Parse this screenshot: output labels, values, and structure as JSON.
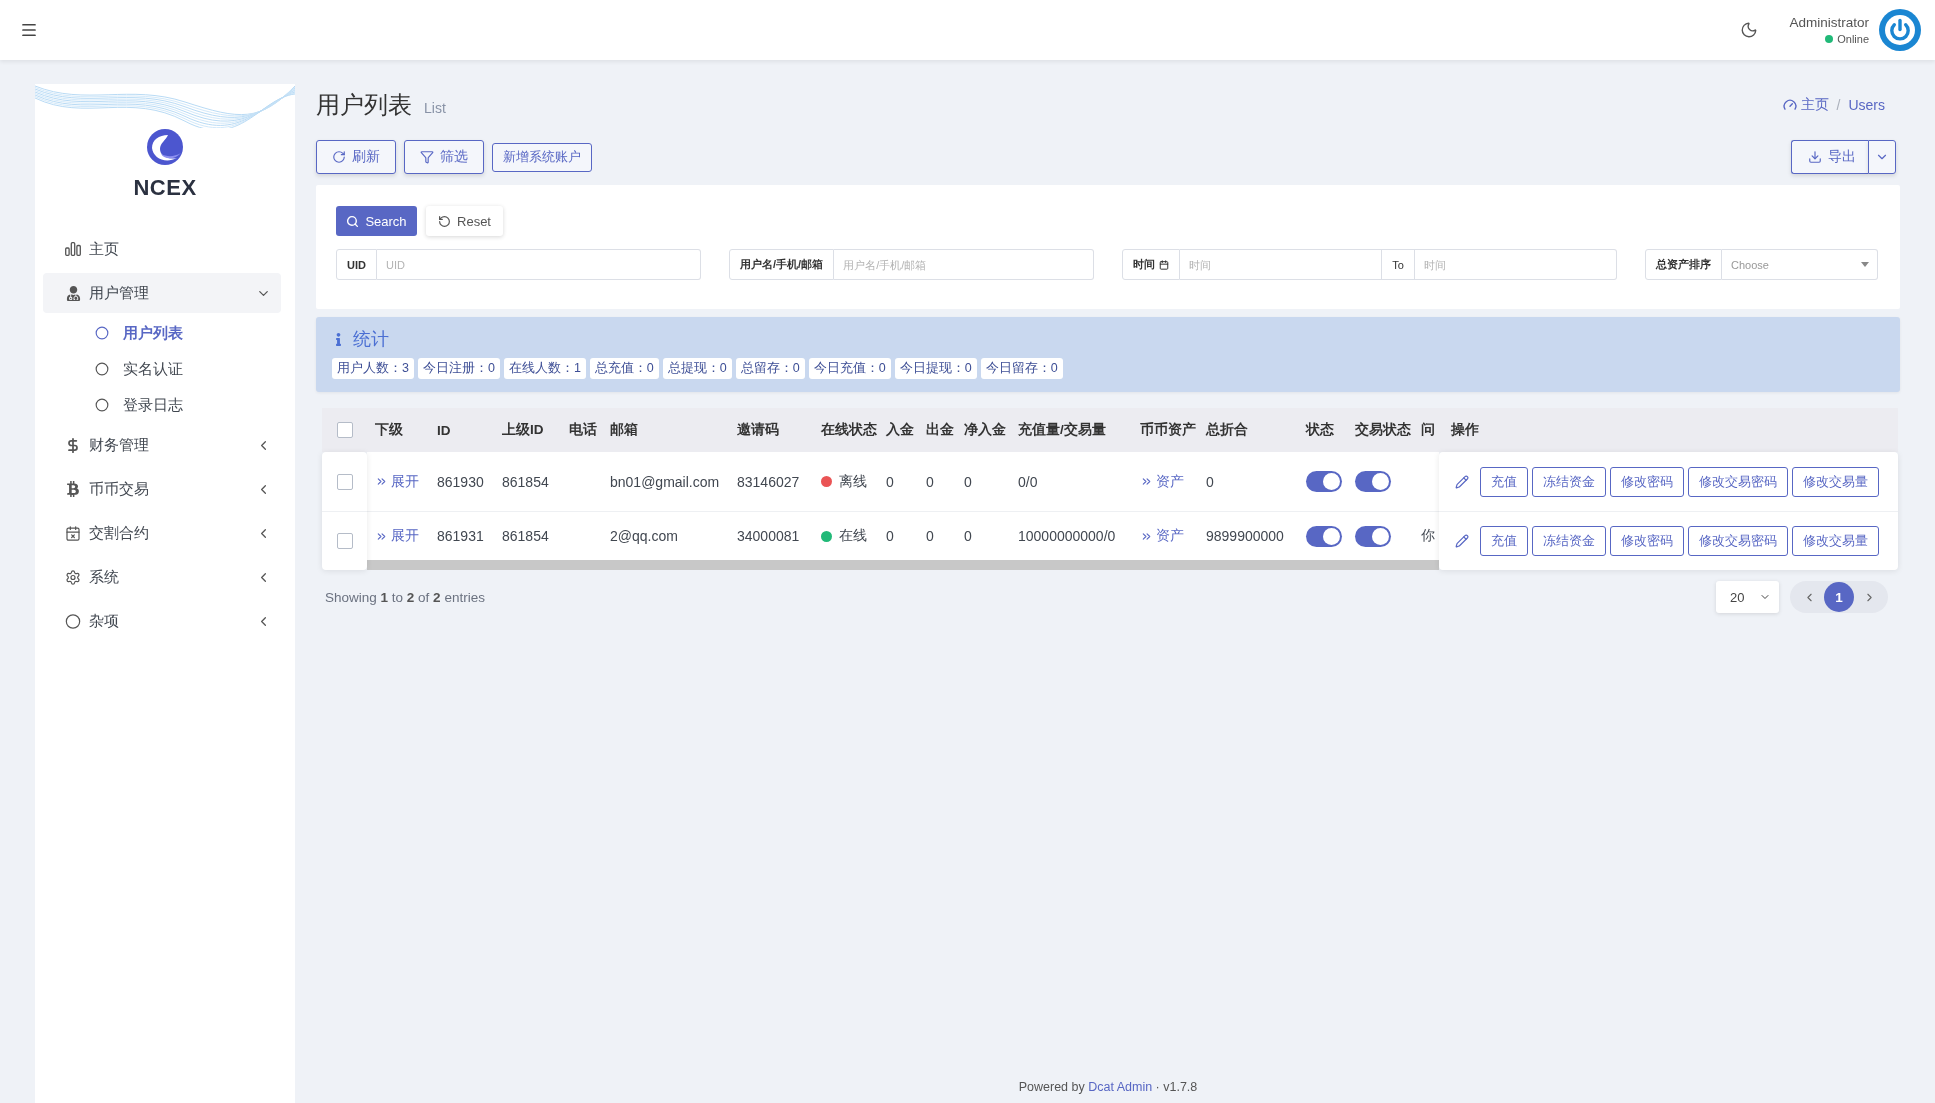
{
  "header": {
    "user_name": "Administrator",
    "user_status": "Online"
  },
  "sidebar": {
    "brand": "NCEX",
    "items": [
      {
        "label": "主页",
        "selected": false
      },
      {
        "label": "用户管理",
        "selected": false,
        "expanded": true,
        "children": [
          {
            "label": "用户列表",
            "selected": true
          },
          {
            "label": "实名认证",
            "selected": false
          },
          {
            "label": "登录日志",
            "selected": false
          }
        ]
      },
      {
        "label": "财务管理",
        "selected": false,
        "expanded": false
      },
      {
        "label": "币币交易",
        "selected": false,
        "expanded": false
      },
      {
        "label": "交割合约",
        "selected": false,
        "expanded": false
      },
      {
        "label": "系统",
        "selected": false,
        "expanded": false
      },
      {
        "label": "杂项",
        "selected": false,
        "expanded": false
      }
    ]
  },
  "page": {
    "title": "用户列表",
    "subtitle": "List",
    "breadcrumb": {
      "items": [
        "主页",
        "Users"
      ],
      "separator": "/"
    }
  },
  "toolbar": {
    "buttons": [
      {
        "kind": "refresh",
        "label": "刷新"
      },
      {
        "kind": "filter",
        "label": "筛选"
      },
      {
        "kind": "create",
        "label": "新增系统账户"
      }
    ],
    "export": {
      "label": "导出"
    }
  },
  "filter": {
    "search": "Search",
    "reset": "Reset",
    "fields": [
      {
        "kind": "text",
        "label": "UID",
        "placeholder": "UID"
      },
      {
        "kind": "text",
        "label": "用户名/手机/邮箱",
        "placeholder": "用户名/手机/邮箱"
      },
      {
        "kind": "range",
        "label": "时间",
        "placeholder": "时间",
        "separator": "To",
        "end_placeholder": "时间"
      },
      {
        "kind": "select",
        "label": "总资产排序",
        "placeholder": "Choose"
      }
    ]
  },
  "stats": {
    "title": "统计",
    "items": [
      "用户人数：3",
      "今日注册：0",
      "在线人数：1",
      "总充值：0",
      "总提现：0",
      "总留存：0",
      "今日充值：0",
      "今日提现：0",
      "今日留存：0"
    ]
  },
  "table": {
    "select_all": {
      "checked": false
    },
    "columns": [
      "下级",
      "ID",
      "上级ID",
      "电话",
      "邮箱",
      "邀请码",
      "在线状态",
      "入金",
      "出金",
      "净入金",
      "充值量/交易量",
      "币币资产",
      "总折合",
      "状态",
      "交易状态",
      "问",
      "操作"
    ],
    "rows": [
      {
        "selected": false,
        "subordinates": "展开",
        "id": "861930",
        "parent_id": "861854",
        "email": "bn01@gmail.com",
        "invite_code": "83146027",
        "online": {
          "label": "离线",
          "color": "#ea5455"
        },
        "deposit": "0",
        "withdrawal": "0",
        "net_deposit": "0",
        "recharge_trade": "0/0",
        "assets": "资产",
        "total": "0",
        "status": {
          "on": true
        },
        "trade_status": {
          "on": true
        },
        "actions": [
          "充值",
          "冻结资金",
          "修改密码",
          "修改交易密码",
          "修改交易量"
        ]
      },
      {
        "selected": false,
        "subordinates": "展开",
        "id": "861931",
        "parent_id": "861854",
        "email": "2@qq.com",
        "invite_code": "34000081",
        "online": {
          "label": "在线",
          "color": "#21b978"
        },
        "deposit": "0",
        "withdrawal": "0",
        "net_deposit": "0",
        "recharge_trade": "10000000000/0",
        "assets": "资产",
        "total": "9899900000",
        "status": {
          "on": true
        },
        "trade_status": {
          "on": true
        },
        "column_16": "你",
        "actions": [
          "充值",
          "冻结资金",
          "修改密码",
          "修改交易密码",
          "修改交易量"
        ]
      }
    ]
  },
  "pagination": {
    "summary": "Showing **1** to **2** of **2** entries",
    "per_page": "20",
    "pages": [
      {
        "label": "1",
        "selected": true
      }
    ]
  },
  "footer": {
    "prefix": "Powered by",
    "link": "Dcat Admin",
    "suffix": "· v1.7.8"
  }
}
